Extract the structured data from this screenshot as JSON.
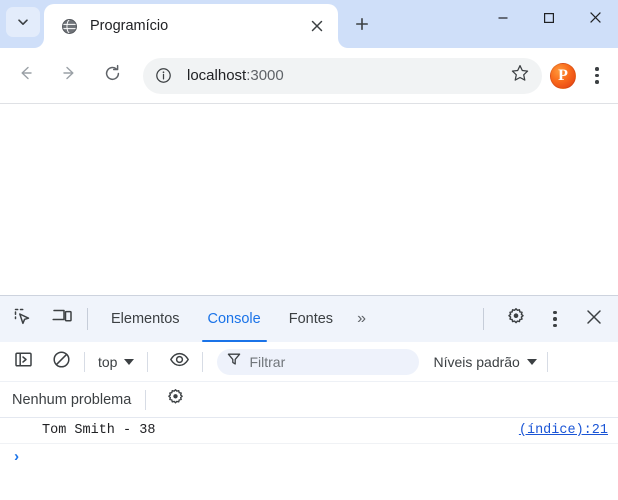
{
  "browser": {
    "tab": {
      "title": "Programício",
      "favicon_icon": "globe-icon",
      "close_icon": "close-icon"
    },
    "tab_search_icon": "chevron-down-icon",
    "new_tab_icon": "plus-icon",
    "window_controls": {
      "minimize_icon": "minimize-icon",
      "maximize_icon": "maximize-icon",
      "close_icon": "close-icon"
    },
    "nav": {
      "back_icon": "arrow-left-icon",
      "forward_icon": "arrow-right-icon",
      "reload_icon": "reload-icon"
    },
    "omnibox": {
      "site_info_icon": "info-circle-icon",
      "url_host": "localhost",
      "url_port": ":3000",
      "bookmark_icon": "star-icon"
    },
    "profile": {
      "avatar_letter": "P",
      "avatar_color": "#f2600c"
    },
    "menu_icon": "three-dots-vertical-icon"
  },
  "devtools": {
    "left_icons": [
      {
        "name": "inspect-element-icon"
      },
      {
        "name": "device-toolbar-icon"
      }
    ],
    "tabs": [
      {
        "label": "Elementos",
        "active": false
      },
      {
        "label": "Console",
        "active": true
      },
      {
        "label": "Fontes",
        "active": false
      }
    ],
    "more_tabs_label": "»",
    "right_icons": [
      {
        "name": "settings-gear-icon"
      },
      {
        "name": "three-dots-vertical-icon"
      },
      {
        "name": "close-icon"
      }
    ],
    "console_toolbar": {
      "sidebar_toggle_icon": "console-sidebar-icon",
      "clear_console_icon": "clear-console-icon",
      "context_label": "top",
      "context_caret_icon": "chevron-down-icon",
      "live_expression_icon": "eye-icon",
      "filter_icon": "filter-funnel-icon",
      "filter_placeholder": "Filtrar",
      "levels_label": "Níveis padrão",
      "levels_caret_icon": "chevron-down-icon"
    },
    "issues_bar": {
      "text": "Nenhum problema",
      "settings_icon": "settings-gear-icon"
    },
    "console_output": [
      {
        "message": "Tom Smith - 38",
        "source": "(índice):21"
      }
    ],
    "prompt_symbol": "›"
  },
  "colors": {
    "titlebar": "#cfdff9",
    "devtools_tabbar": "#f0f4fb",
    "accent_blue": "#1a73e8",
    "link_blue": "#1a55d6"
  }
}
